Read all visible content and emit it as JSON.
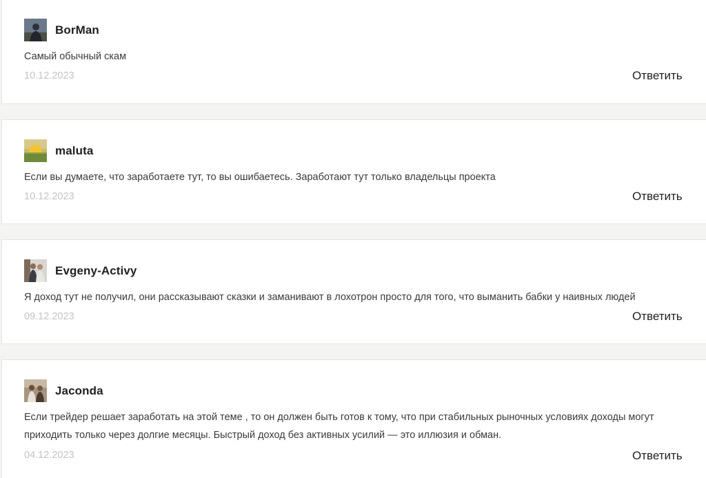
{
  "comments": [
    {
      "author": "BorMan",
      "text": "Самый обычный скам",
      "date": "10.12.2023",
      "reply_label": "Ответить",
      "avatar_icon": "user-photo-avatar"
    },
    {
      "author": "maluta",
      "text": "Если вы думаете, что заработаете тут, то вы ошибаетесь. Заработают тут только владельцы проекта",
      "date": "10.12.2023",
      "reply_label": "Ответить",
      "avatar_icon": "sunset-avatar"
    },
    {
      "author": "Evgeny-Activy",
      "text": "Я доход тут не получил, они рассказывают сказки и заманивают в лохотрон просто для того, что выманить бабки у наивных людей",
      "date": "09.12.2023",
      "reply_label": "Ответить",
      "avatar_icon": "user-photo-avatar"
    },
    {
      "author": "Jaconda",
      "text": "Если трейдер решает заработать на этой теме , то он должен быть готов к тому, что при стабильных рыночных условиях доходы могут приходить только через долгие месяцы. Быстрый доход без активных усилий — это иллюзия и обман.",
      "date": "04.12.2023",
      "reply_label": "Ответить",
      "avatar_icon": "user-photo-avatar"
    }
  ],
  "colors": {
    "page_background": "#f4f4f2",
    "card_background": "#ffffff",
    "author_text": "#1f1f1f",
    "body_text": "#3a3a3a",
    "date_text": "#c3c3c3"
  }
}
